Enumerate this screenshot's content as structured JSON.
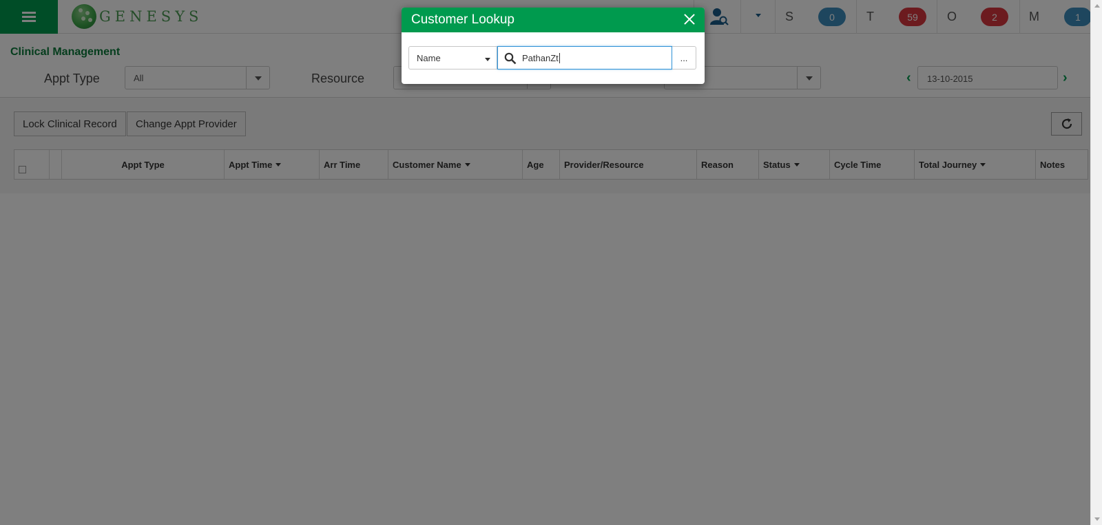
{
  "header": {
    "logo_text": "GENESYS",
    "queues": [
      {
        "letter": "S",
        "count": "0",
        "color": "#3c8dbc"
      },
      {
        "letter": "T",
        "count": "59",
        "color": "#d9363e"
      },
      {
        "letter": "O",
        "count": "2",
        "color": "#d9363e"
      },
      {
        "letter": "M",
        "count": "1",
        "color": "#3c8dbc"
      }
    ]
  },
  "page": {
    "title": "Clinical Management",
    "filters": {
      "appt_type_label": "Appt Type",
      "appt_type_value": "All",
      "resource_label": "Resource",
      "resource_value": "",
      "third_value": "",
      "date": "13-10-2015"
    },
    "buttons": {
      "lock": "Lock Clinical Record",
      "change_provider": "Change Appt Provider"
    },
    "grid_columns": [
      "Appt Type",
      "Appt Time",
      "Arr Time",
      "Customer Name",
      "Age",
      "Provider/Resource",
      "Reason",
      "Status",
      "Cycle Time",
      "Total Journey",
      "Notes"
    ]
  },
  "modal": {
    "title": "Customer Lookup",
    "search_by": "Name",
    "search_value": "PathanZt",
    "more_label": "..."
  },
  "colors": {
    "brand_green": "#009a4e",
    "title_green": "#0b7a3b",
    "badge_blue": "#3c8dbc",
    "badge_red": "#d9363e",
    "focus_blue": "#2a8fd6"
  }
}
